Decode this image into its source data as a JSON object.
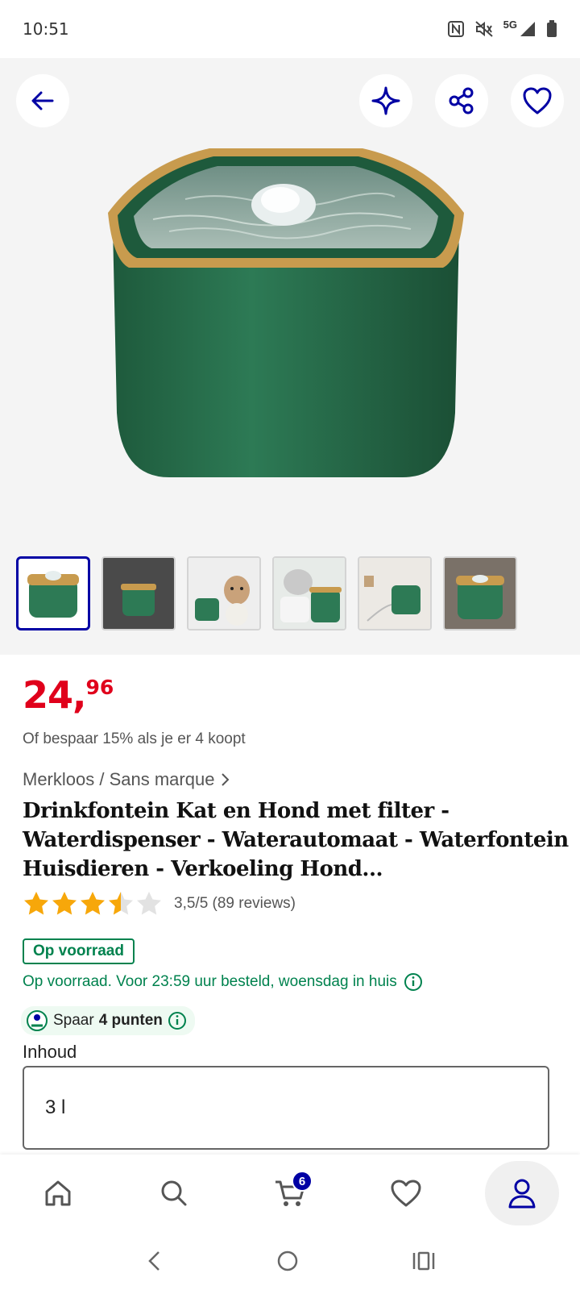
{
  "status_bar": {
    "time": "10:51",
    "network": "5G"
  },
  "gallery": {
    "back_icon": "arrow-left-icon",
    "actions": [
      "sparkle-icon",
      "share-icon",
      "heart-icon"
    ],
    "thumbnail_count": 6,
    "selected_thumbnail": 1
  },
  "product": {
    "price_main": "24,",
    "price_cents": "96",
    "bundle_offer": "Of bespaar 15% als je er 4 koopt",
    "brand": "Merkloos / Sans marque",
    "title": "Drinkfontein Kat en Hond met filter - Waterdispenser - Waterautomaat - Waterfontein Huisdieren - Verkoeling Hond...",
    "rating_value": 3.5,
    "rating_max": 5,
    "rating_text": "3,5/5 (89 reviews)",
    "stock_badge": "Op voorraad",
    "delivery": "Op voorraad. Voor 23:59 uur besteld, woensdag in huis",
    "points_prefix": "Spaar",
    "points_value": "4 punten",
    "variant_label": "Inhoud",
    "variant_value": "3 l"
  },
  "bottom_nav": {
    "items": [
      "home-icon",
      "search-icon",
      "cart-icon",
      "heart-icon",
      "account-icon"
    ],
    "cart_count": "6",
    "active": "account"
  },
  "colors": {
    "accent": "#0000a4",
    "price": "#e0001b",
    "stock": "#00824e",
    "star": "#f7a70a"
  }
}
